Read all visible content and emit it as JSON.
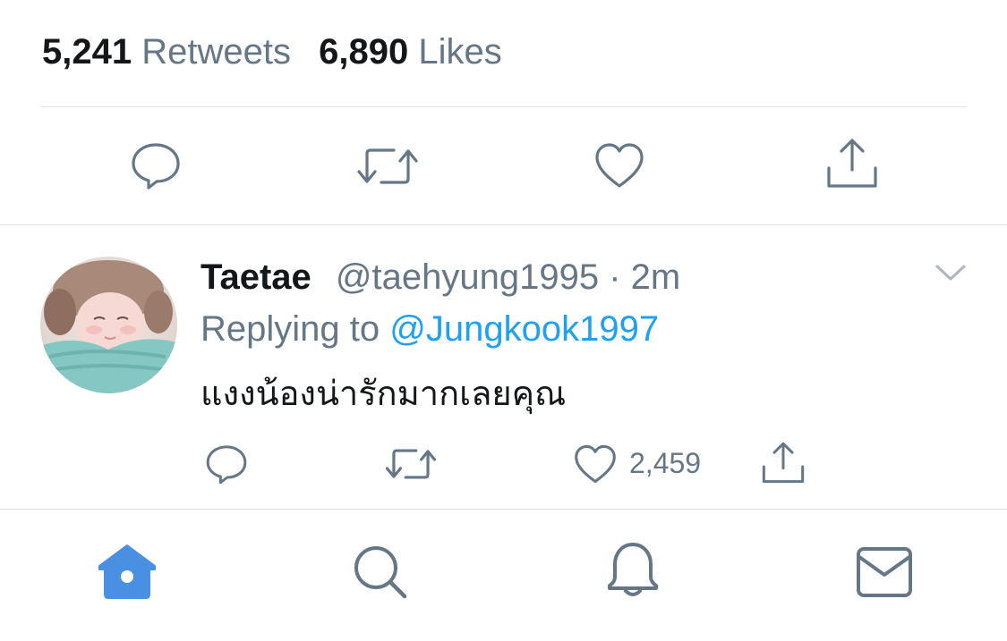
{
  "stats": {
    "retweets_count": "5,241",
    "retweets_label": "Retweets",
    "likes_count": "6,890",
    "likes_label": "Likes"
  },
  "main_actions": {
    "icons": [
      "reply-icon",
      "retweet-icon",
      "like-icon",
      "share-icon"
    ]
  },
  "reply": {
    "display_name": "Taetae",
    "handle": "@taehyung1995",
    "separator": "·",
    "time": "2m",
    "replying_prefix": "Replying to",
    "replying_to": "@Jungkook1997",
    "text": "แงงน้องน่ารักมากเลยคุณ",
    "like_count": "2,459"
  },
  "bottom_nav": {
    "items": [
      "home-icon",
      "search-icon",
      "notifications-icon",
      "messages-icon"
    ],
    "active": "home-icon"
  },
  "colors": {
    "text": "#14171a",
    "secondary": "#657786",
    "accent": "#1da1f2",
    "active_nav": "#4a90e2",
    "divider": "#dfe3e6"
  }
}
